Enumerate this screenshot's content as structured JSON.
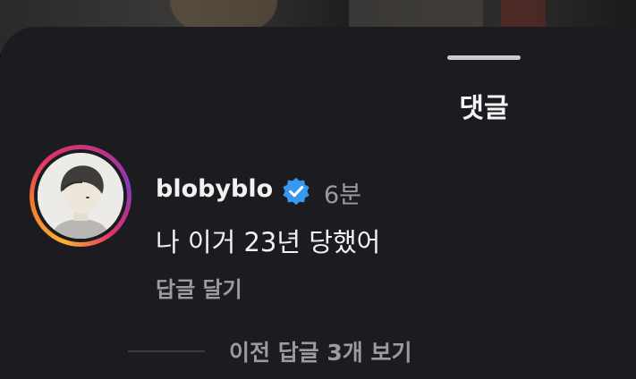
{
  "sheet": {
    "title": "댓글"
  },
  "comment": {
    "username": "blobyblo",
    "verified_icon": "verified-badge-icon",
    "time": "6분",
    "text": "나 이거 23년 당했어",
    "reply_label": "답글 달기",
    "view_replies_label": "이전 답글 3개 보기"
  },
  "colors": {
    "sheet_bg": "#1c1c20",
    "text_primary": "#f2f2f2",
    "text_secondary": "#9a9ca3",
    "verified_blue": "#3897f0",
    "story_ring_start": "#f9b233",
    "story_ring_end": "#833ab4"
  }
}
